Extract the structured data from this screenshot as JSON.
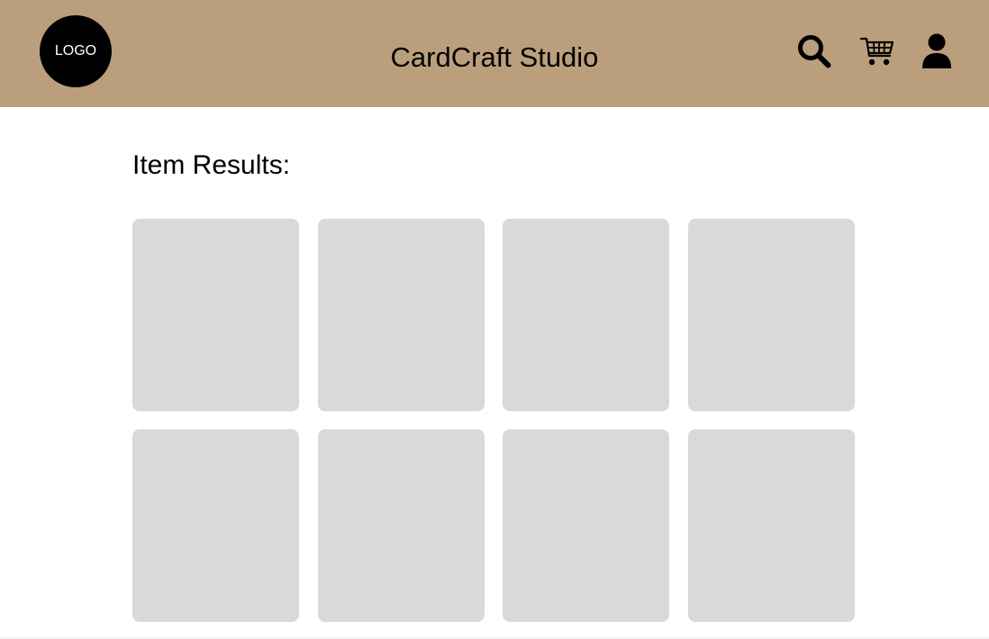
{
  "header": {
    "logo_label": "LOGO",
    "title": "CardCraft Studio",
    "background_color": "#bb9f7c",
    "icons": [
      "search-icon",
      "cart-icon",
      "user-icon"
    ]
  },
  "main": {
    "results_heading": "Item Results:",
    "cards": [
      {
        "placeholder_color": "#d9d9d9"
      },
      {
        "placeholder_color": "#d9d9d9"
      },
      {
        "placeholder_color": "#d9d9d9"
      },
      {
        "placeholder_color": "#d9d9d9"
      },
      {
        "placeholder_color": "#d9d9d9"
      },
      {
        "placeholder_color": "#d9d9d9"
      },
      {
        "placeholder_color": "#d9d9d9"
      },
      {
        "placeholder_color": "#d9d9d9"
      }
    ]
  }
}
